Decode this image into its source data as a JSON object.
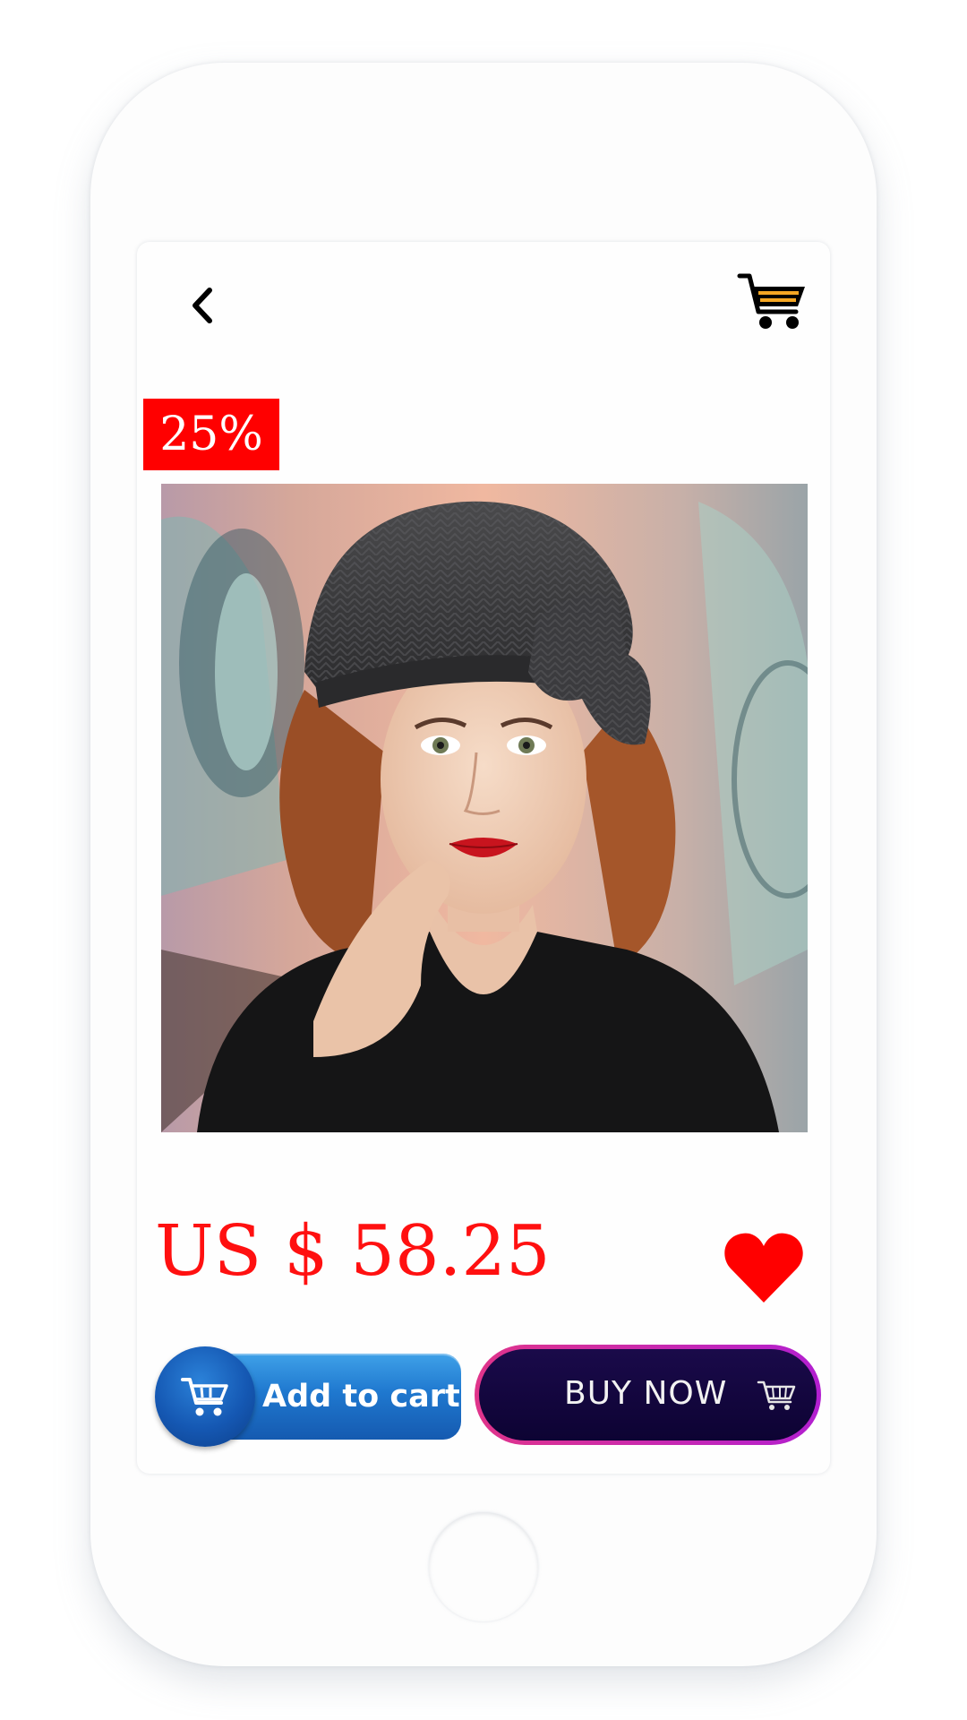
{
  "header": {
    "back_icon": "chevron-left-icon",
    "cart_icon": "shopping-cart-icon",
    "cart_accent": "#f5a623"
  },
  "product": {
    "discount_badge": "25%",
    "discount_color": "#ff0000",
    "image": "woman-wearing-gray-herringbone-beret",
    "price": "US $ 58.25",
    "price_color": "#ff1010",
    "wishlist_icon": "heart-icon",
    "wishlist_color": "#ff0000"
  },
  "actions": {
    "add_to_cart_label": "Add to cart",
    "buy_now_label": "BUY NOW"
  }
}
